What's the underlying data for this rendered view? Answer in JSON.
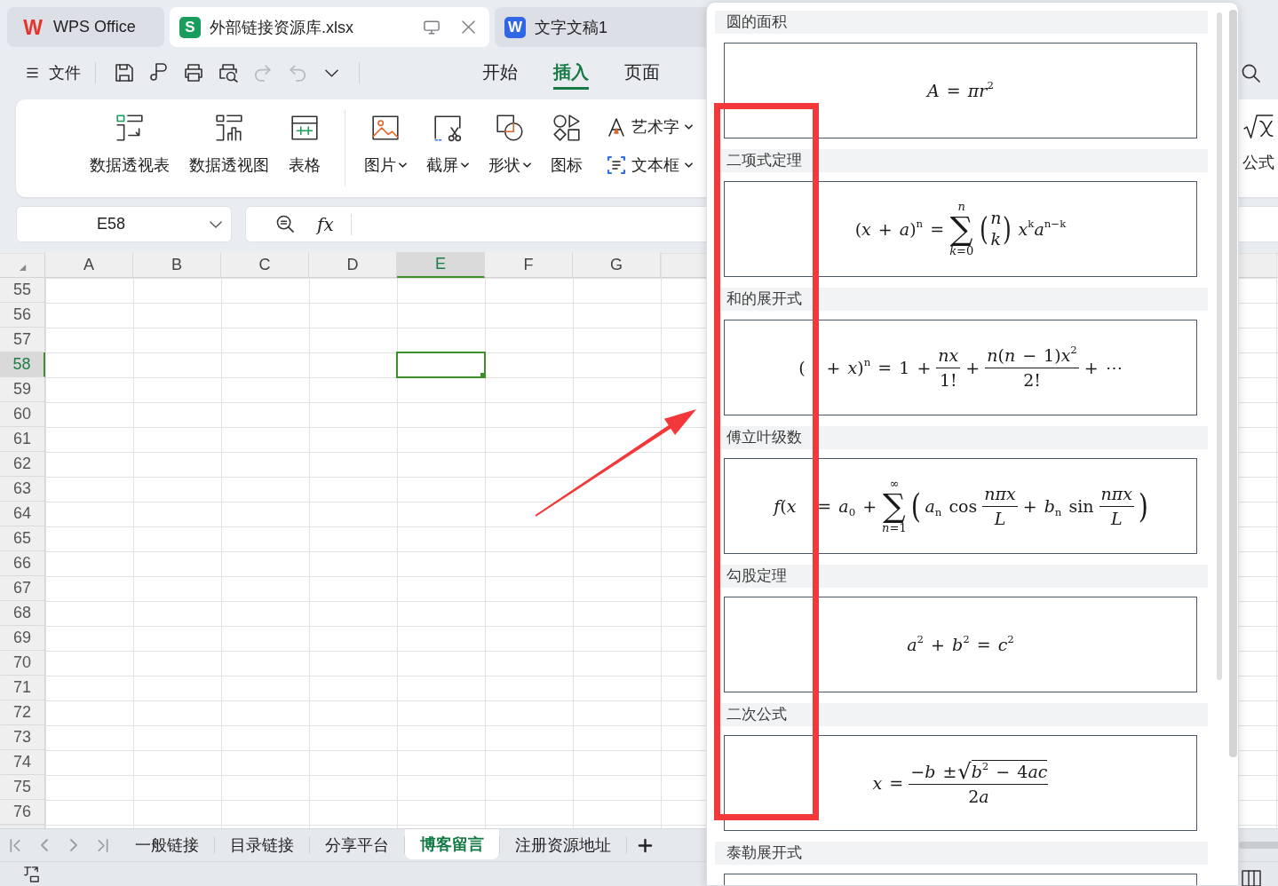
{
  "window_tabs": [
    {
      "kind": "home",
      "badge": "W",
      "label": "WPS Office",
      "selected": false
    },
    {
      "kind": "sheet",
      "badge": "S",
      "label": "外部链接资源库.xlsx",
      "selected": true
    },
    {
      "kind": "doc",
      "badge": "W",
      "label": "文字文稿1",
      "selected": false
    }
  ],
  "menu_bar": {
    "file_label": "文件",
    "quick_tools": [
      {
        "kind": "save",
        "disabled": false
      },
      {
        "kind": "brush",
        "disabled": false
      },
      {
        "kind": "print",
        "disabled": false
      },
      {
        "kind": "preview",
        "disabled": false
      },
      {
        "kind": "redo",
        "disabled": true
      },
      {
        "kind": "undo",
        "disabled": true
      },
      {
        "kind": "more",
        "disabled": false
      }
    ],
    "tabs": [
      {
        "label": "开始",
        "selected": false
      },
      {
        "label": "插入",
        "selected": true
      },
      {
        "label": "页面",
        "selected": false
      }
    ]
  },
  "ribbon": {
    "large_items": [
      {
        "kind": "pivot-table",
        "label": "数据透视表",
        "dropdown": false
      },
      {
        "kind": "pivot-chart",
        "label": "数据透视图",
        "dropdown": false
      },
      {
        "kind": "table",
        "label": "表格",
        "dropdown": false
      },
      {
        "kind": "separator"
      },
      {
        "kind": "picture",
        "label": "图片",
        "dropdown": true
      },
      {
        "kind": "screenshot",
        "label": "截屏",
        "dropdown": true
      },
      {
        "kind": "shapes",
        "label": "形状",
        "dropdown": true
      },
      {
        "kind": "icons",
        "label": "图标",
        "dropdown": false
      }
    ],
    "small_items": [
      {
        "kind": "wordart",
        "label": "艺术字",
        "dropdown": true
      },
      {
        "kind": "text-box",
        "label": "文本框",
        "dropdown": true
      }
    ],
    "formula_button": {
      "label": "公式"
    }
  },
  "formula_bar": {
    "name_box": "E58",
    "function_label": "fx"
  },
  "grid": {
    "columns": [
      {
        "label": "A",
        "selected": false
      },
      {
        "label": "B",
        "selected": false
      },
      {
        "label": "C",
        "selected": false
      },
      {
        "label": "D",
        "selected": false
      },
      {
        "label": "E",
        "selected": true
      },
      {
        "label": "F",
        "selected": false
      },
      {
        "label": "G",
        "selected": false
      }
    ],
    "rows": [
      {
        "label": "55",
        "selected": false
      },
      {
        "label": "56",
        "selected": false
      },
      {
        "label": "57",
        "selected": false
      },
      {
        "label": "58",
        "selected": true
      },
      {
        "label": "59",
        "selected": false
      },
      {
        "label": "60",
        "selected": false
      },
      {
        "label": "61",
        "selected": false
      },
      {
        "label": "62",
        "selected": false
      },
      {
        "label": "63",
        "selected": false
      },
      {
        "label": "64",
        "selected": false
      },
      {
        "label": "65",
        "selected": false
      },
      {
        "label": "66",
        "selected": false
      },
      {
        "label": "67",
        "selected": false
      },
      {
        "label": "68",
        "selected": false
      },
      {
        "label": "69",
        "selected": false
      },
      {
        "label": "70",
        "selected": false
      },
      {
        "label": "71",
        "selected": false
      },
      {
        "label": "72",
        "selected": false
      },
      {
        "label": "73",
        "selected": false
      },
      {
        "label": "74",
        "selected": false
      },
      {
        "label": "75",
        "selected": false
      },
      {
        "label": "76",
        "selected": false
      }
    ]
  },
  "sheet_tabs": [
    {
      "label": "一般链接",
      "selected": false
    },
    {
      "label": "目录链接",
      "selected": false
    },
    {
      "label": "分享平台",
      "selected": false
    },
    {
      "label": "博客留言",
      "selected": true
    },
    {
      "label": "注册资源地址",
      "selected": false
    }
  ],
  "formula_panel": {
    "sections": [
      {
        "title": "圆的面积",
        "formula": [
          {
            "kind": "text",
            "text": "*A* = *πr*$^{2}$"
          }
        ]
      },
      {
        "title": "二项式定理",
        "formula": [
          {
            "kind": "text",
            "text": "(*x* + *a*)$^{n}$ ="
          },
          {
            "kind": "sum",
            "symbol": "∑",
            "over": "*n*",
            "under": "*k*=0"
          },
          {
            "kind": "binom",
            "open": "(",
            "top": "*n*",
            "bottom": "*k*",
            "close": ")"
          },
          {
            "kind": "text",
            "text": "*x*$^{k}$*a*$^{n−k}$"
          }
        ]
      },
      {
        "title": "和的展开式",
        "formula": [
          {
            "kind": "text",
            "text": "("
          },
          {
            "kind": "text",
            "text": "+ *x*)$^{n}$ = 1 +"
          },
          {
            "kind": "frac",
            "num": [
              {
                "kind": "text",
                "text": "*nx*"
              }
            ],
            "den": [
              {
                "kind": "text",
                "text": "1!"
              }
            ]
          },
          {
            "kind": "text",
            "text": "+"
          },
          {
            "kind": "frac",
            "num": [
              {
                "kind": "text",
                "text": "*n*(*n* − 1)*x*$^{2}$"
              }
            ],
            "den": [
              {
                "kind": "text",
                "text": "2!"
              }
            ]
          },
          {
            "kind": "text",
            "text": "+ ⋯"
          }
        ]
      },
      {
        "title": "傅立叶级数",
        "formula": [
          {
            "kind": "text",
            "text": "*f*(*x*"
          },
          {
            "kind": "text",
            "text": "= *a*$_{0}$ +"
          },
          {
            "kind": "sum",
            "symbol": "∑",
            "over": "∞",
            "under": "*n*=1"
          },
          {
            "kind": "delimiter",
            "text": "("
          },
          {
            "kind": "text",
            "text": "*a*$_{n}$ cos"
          },
          {
            "kind": "frac",
            "num": [
              {
                "kind": "text",
                "text": "*nπx*"
              }
            ],
            "den": [
              {
                "kind": "text",
                "text": "*L*"
              }
            ]
          },
          {
            "kind": "text",
            "text": "+ *b*$_{n}$ sin"
          },
          {
            "kind": "frac",
            "num": [
              {
                "kind": "text",
                "text": "*nπx*"
              }
            ],
            "den": [
              {
                "kind": "text",
                "text": "*L*"
              }
            ]
          },
          {
            "kind": "delimiter",
            "text": ")"
          }
        ]
      },
      {
        "title": "勾股定理",
        "formula": [
          {
            "kind": "text",
            "text": "*a*$^{2}$ + *b*$^{2}$ = *c*$^{2}$"
          }
        ]
      },
      {
        "title": "二次公式",
        "formula": [
          {
            "kind": "text",
            "text": "*x* ="
          },
          {
            "kind": "frac",
            "num": [
              {
                "kind": "text",
                "text": "−*b* ±"
              },
              {
                "kind": "root",
                "symbol": "√",
                "body": [
                  {
                    "kind": "text",
                    "text": "*b*$^{2}$ − 4"
                  },
                  {
                    "kind": "text",
                    "text": "*ac*"
                  }
                ]
              }
            ],
            "den": [
              {
                "kind": "text",
                "text": "2"
              },
              {
                "kind": "text",
                "text": "*a*"
              }
            ]
          }
        ]
      },
      {
        "title": "泰勒展开式"
      }
    ]
  },
  "annotations": {
    "highlight_frame": true,
    "pointer_arrow": true
  }
}
